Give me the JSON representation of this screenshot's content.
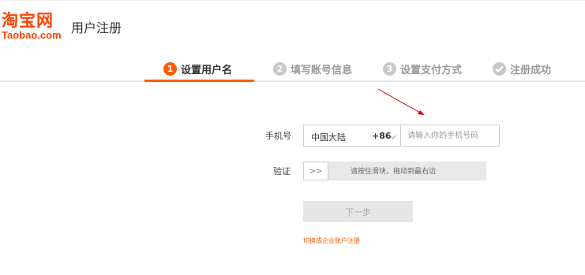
{
  "header": {
    "logo_cn": "淘宝网",
    "logo_en": "Taobao.com",
    "title": "用户注册"
  },
  "steps": [
    {
      "num": "1",
      "label": "设置用户名",
      "state": "active"
    },
    {
      "num": "2",
      "label": "填写账号信息",
      "state": "inactive"
    },
    {
      "num": "3",
      "label": "设置支付方式",
      "state": "inactive"
    },
    {
      "num": "",
      "label": "注册成功",
      "state": "inactive",
      "icon": "check-circle-icon"
    }
  ],
  "form": {
    "phone_label": "手机号",
    "region": "中国大陆",
    "country_code": "+86",
    "phone_placeholder": "请输入你的手机号码",
    "verify_label": "验证",
    "slider_handle": ">>",
    "slider_text": "请按住滑块，拖动到最右边",
    "next_button": "下一步",
    "enterprise_link": "切换成企业账户注册"
  },
  "colors": {
    "brand": "#ff4400",
    "accent": "#ff5a00",
    "annotation_arrow": "#cc0000"
  }
}
